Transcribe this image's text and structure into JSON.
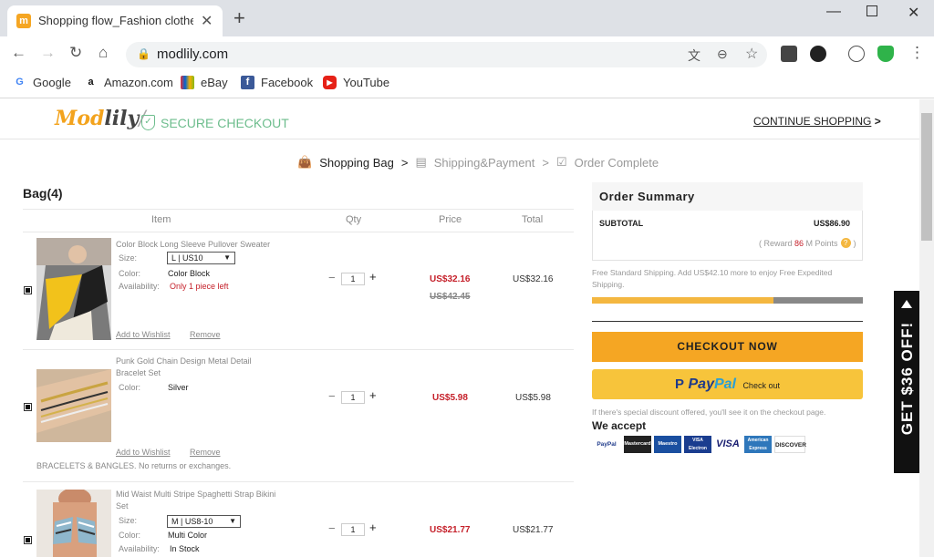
{
  "browser": {
    "tab_title": "Shopping flow_Fashion clothes &",
    "url": "modlily.com",
    "bookmarks": [
      {
        "label": "Google",
        "icon": "google-icon"
      },
      {
        "label": "Amazon.com",
        "icon": "amazon-icon"
      },
      {
        "label": "eBay",
        "icon": "ebay-icon"
      },
      {
        "label": "Facebook",
        "icon": "facebook-icon"
      },
      {
        "label": "YouTube",
        "icon": "youtube-icon"
      }
    ]
  },
  "header": {
    "logo_mod": "Mod",
    "logo_lily": "lily",
    "secure": "SECURE CHECKOUT",
    "continue": "CONTINUE SHOPPING",
    "continue_arrow": ">"
  },
  "steps": {
    "step1": "Shopping Bag",
    "sep1": ">",
    "step2": "Shipping&Payment",
    "sep2": ">",
    "step3": "Order Complete"
  },
  "bag": {
    "title": "Bag(4)",
    "col_item": "Item",
    "col_qty": "Qty",
    "col_price": "Price",
    "col_total": "Total",
    "items": [
      {
        "name": "Color Block Long Sleeve Pullover Sweater",
        "size_label": "Size:",
        "size": "L | US10",
        "color_label": "Color:",
        "color": "Color Block",
        "avail_label": "Availability:",
        "availability": "Only 1 piece left",
        "qty": "1",
        "price": "US$32.16",
        "old_price": "US$42.45",
        "total": "US$32.16",
        "wishlist": "Add to Wishlist",
        "remove": "Remove"
      },
      {
        "name": "Punk Gold Chain Design Metal Detail Bracelet Set",
        "color_label": "Color:",
        "color": "Silver",
        "qty": "1",
        "price": "US$5.98",
        "total": "US$5.98",
        "wishlist": "Add to Wishlist",
        "remove": "Remove",
        "note": "BRACELETS & BANGLES. No returns or exchanges."
      },
      {
        "name": "Mid Waist Multi Stripe Spaghetti Strap Bikini Set",
        "size_label": "Size:",
        "size": "M | US8-10",
        "color_label": "Color:",
        "color": "Multi Color",
        "avail_label": "Availability:",
        "availability": "In Stock",
        "qty": "1",
        "price": "US$21.77",
        "total": "US$21.77"
      }
    ]
  },
  "summary": {
    "title": "Order Summary",
    "subtotal_label": "SUBTOTAL",
    "subtotal": "US$86.90",
    "reward_pre": "( Reward ",
    "reward_points": "86",
    "reward_post": " M Points",
    "reward_close": ")",
    "shipping_note": "Free Standard Shipping. Add US$42.10 more to enjoy Free Expedited Shipping.",
    "shipping_progress": 0.67,
    "checkout": "CHECKOUT NOW",
    "paypal_a": "Pay",
    "paypal_b": "Pal",
    "paypal_checkout": "Check out",
    "discount_note": "If there's special discount offered, you'll see it on the checkout page.",
    "we_accept": "We accept",
    "cards": [
      "PayPal",
      "Mastercard",
      "Maestro",
      "VISA Electron",
      "VISA",
      "American Express",
      "DISCOVER"
    ]
  },
  "promo": {
    "text": "GET $36 OFF!"
  },
  "colors": {
    "accent": "#f5a623",
    "price_red": "#c5202a",
    "secure_green": "#6dbd8d"
  }
}
